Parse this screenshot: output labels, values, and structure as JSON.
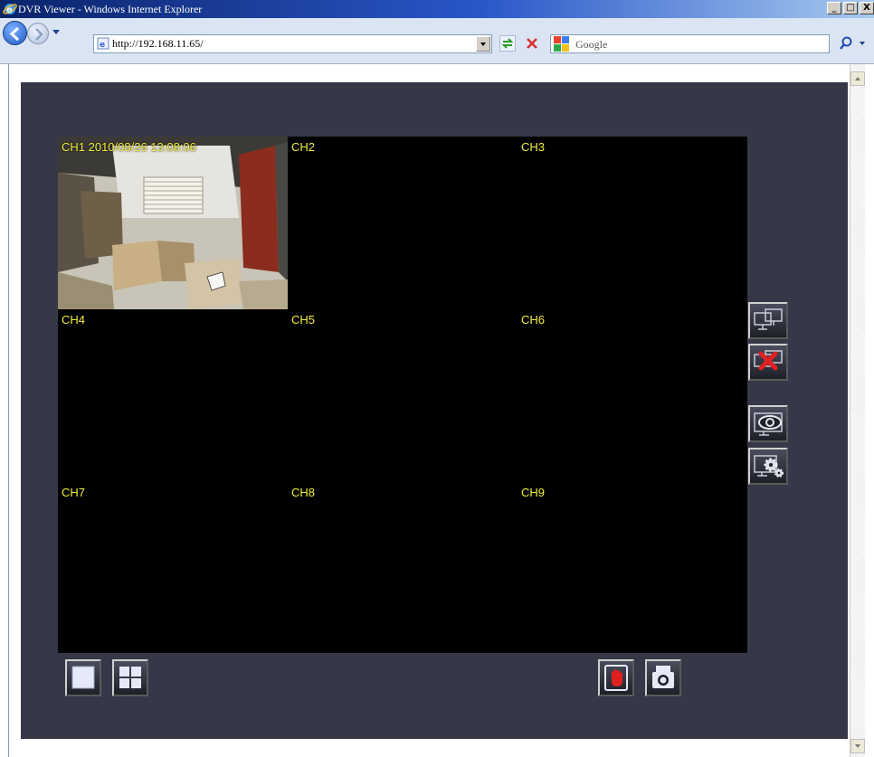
{
  "window": {
    "title": "DVR Viewer - Windows Internet Explorer",
    "controls": [
      "_",
      "□",
      "X"
    ]
  },
  "browser": {
    "url": "http://192.168.11.65/",
    "search_provider": "Google",
    "icons": [
      "back-icon",
      "forward-icon",
      "refresh-icon",
      "stop-icon",
      "search-icon"
    ]
  },
  "dvr": {
    "channels": [
      {
        "label": "CH1 2010/08/26 13:08:06",
        "has_video": true
      },
      {
        "label": "CH2",
        "has_video": false
      },
      {
        "label": "CH3",
        "has_video": false
      },
      {
        "label": "CH4",
        "has_video": false
      },
      {
        "label": "CH5",
        "has_video": false
      },
      {
        "label": "CH6",
        "has_video": false
      },
      {
        "label": "CH7",
        "has_video": false
      },
      {
        "label": "CH8",
        "has_video": false
      },
      {
        "label": "CH9",
        "has_video": false
      }
    ],
    "side_buttons": [
      "connect-icon",
      "disconnect-icon",
      "live-view-icon",
      "settings-icon"
    ],
    "layout_buttons": [
      "single-view-icon",
      "quad-view-icon"
    ],
    "action_buttons": [
      "manual-record-icon",
      "snapshot-icon"
    ],
    "colors": {
      "panel_bg": "#363848",
      "video_bg": "#000000",
      "channel_label": "#f2ee3a",
      "disconnect_accent": "#e02020",
      "record_accent": "#e02020"
    }
  }
}
